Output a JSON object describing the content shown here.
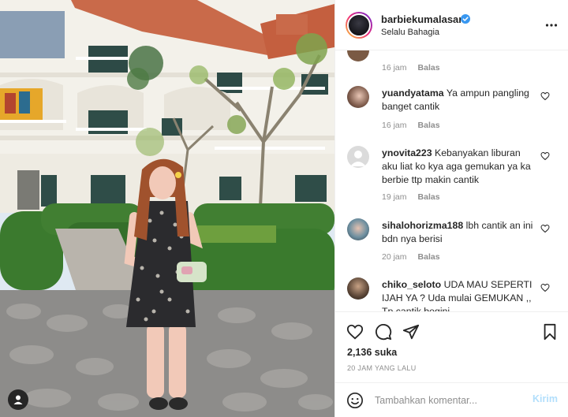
{
  "post": {
    "username": "barbiekumalasari",
    "verified": true,
    "location": "Selalu Bahagia",
    "likes": "2,136 suka",
    "time_ago": "20 JAM YANG LALU"
  },
  "comments": [
    {
      "username": "",
      "text": "",
      "time": "16 jam",
      "reply": "Balas"
    },
    {
      "username": "yuandyatama",
      "text": "Ya ampun pangling banget cantik",
      "time": "16 jam",
      "reply": "Balas"
    },
    {
      "username": "ynovita223",
      "text": "Kebanyakan liburan aku liat ko kya aga gemukan ya ka berbie ttp makin cantik",
      "time": "19 jam",
      "reply": "Balas"
    },
    {
      "username": "sihalohorizma188",
      "text": "lbh cantik an ini bdn nya berisi",
      "time": "20 jam",
      "reply": "Balas"
    },
    {
      "username": "chiko_seloto",
      "text": "UDA MAU SEPERTI IJAH YA ? Uda mulai GEMUKAN ,, Tp cantik begini",
      "time": "",
      "reply": ""
    }
  ],
  "add_comment": {
    "placeholder": "Tambahkan komentar...",
    "post_label": "Kirim"
  },
  "icons": {
    "verified": "verified-badge-icon",
    "more": "more-options-icon",
    "like": "heart-icon",
    "comment": "comment-bubble-icon",
    "share": "paper-plane-icon",
    "save": "bookmark-icon",
    "emoji": "emoji-smile-icon",
    "tag": "user-tag-icon"
  },
  "colors": {
    "verified_blue": "#3897f0",
    "post_button_disabled": "#b2dffc",
    "meta_gray": "#8e8e8e"
  }
}
